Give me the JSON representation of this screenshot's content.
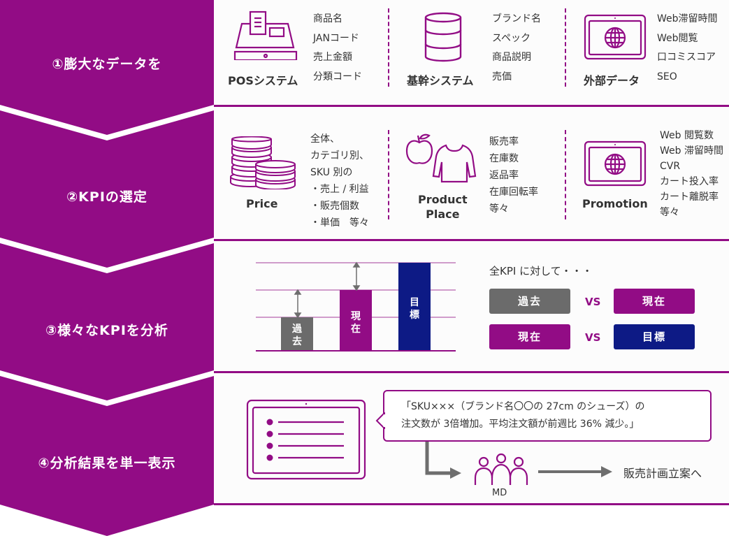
{
  "colors": {
    "brand_purple": "#920c85",
    "past_gray": "#6b6b6b",
    "target_navy": "#0d1a85",
    "arrow_gray": "#6e6e6e",
    "text_dark": "#333333"
  },
  "steps": [
    {
      "label": "①膨大なデータを"
    },
    {
      "label": "②KPIの選定"
    },
    {
      "label": "③様々なKPIを分析"
    },
    {
      "label": "④分析結果を単一表示"
    }
  ],
  "step1": {
    "sources": [
      {
        "icon": "cash-register-icon",
        "caption": "POSシステム",
        "items": [
          "商品名",
          "JANコード",
          "売上金額",
          "分類コード"
        ]
      },
      {
        "icon": "database-icon",
        "caption": "基幹システム",
        "items": [
          "ブランド名",
          "スペック",
          "商品説明",
          "売価"
        ]
      },
      {
        "icon": "tablet-globe-icon",
        "caption": "外部データ",
        "items": [
          "Web滞留時間",
          "Web閲覧",
          "口コミスコア",
          "SEO"
        ]
      }
    ]
  },
  "step2": {
    "kpis": [
      {
        "icon": "coins-icon",
        "caption": "Price",
        "items": [
          "全体、",
          "カテゴリ別、",
          "SKU 別の",
          "・売上 / 利益",
          "・販売個数",
          "・単価　等々"
        ]
      },
      {
        "icon": "apple-shirt-icon",
        "caption_lines": [
          "Product",
          "Place"
        ],
        "items": [
          "販売率",
          "在庫数",
          "返品率",
          "在庫回転率",
          "等々"
        ]
      },
      {
        "icon": "tablet-globe-icon",
        "caption": "Promotion",
        "items": [
          "Web 閲覧数",
          "Web 滞留時間",
          "CVR",
          "カート投入率",
          "カート離脱率",
          "等々"
        ]
      }
    ]
  },
  "step3": {
    "bars": [
      {
        "label": "過去",
        "level": 1,
        "color": "#6b6b6b"
      },
      {
        "label": "現在",
        "level": 2,
        "color": "#920c85"
      },
      {
        "label": "目標",
        "level": 3,
        "color": "#0d1a85"
      }
    ],
    "heading": "全KPI に対して・・・",
    "comparisons": [
      {
        "left": "過去",
        "vs": "VS",
        "right": "現在"
      },
      {
        "left": "現在",
        "vs": "VS",
        "right": "目標"
      }
    ]
  },
  "step4": {
    "bubble_lines": [
      "「SKU×××（ブランド名〇〇の 27cm のシューズ）の",
      "注文数が 3倍増加。平均注文額が前週比 36% 減少。」"
    ],
    "md_label": "MD",
    "next_label": "販売計画立案へ"
  }
}
